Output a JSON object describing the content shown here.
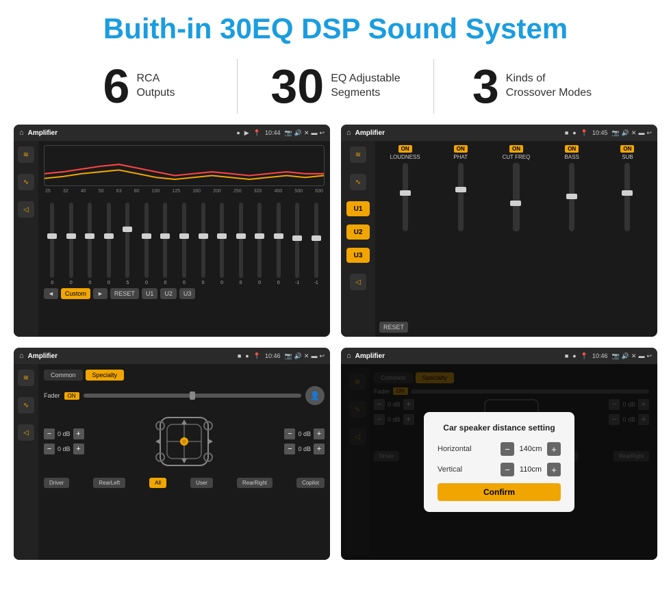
{
  "header": {
    "title": "Buith-in 30EQ DSP Sound System"
  },
  "stats": [
    {
      "number": "6",
      "label_line1": "RCA",
      "label_line2": "Outputs"
    },
    {
      "number": "30",
      "label_line1": "EQ Adjustable",
      "label_line2": "Segments"
    },
    {
      "number": "3",
      "label_line1": "Kinds of",
      "label_line2": "Crossover Modes"
    }
  ],
  "screens": [
    {
      "topbar_title": "Amplifier",
      "topbar_time": "10:44",
      "type": "eq"
    },
    {
      "topbar_title": "Amplifier",
      "topbar_time": "10:45",
      "type": "amp"
    },
    {
      "topbar_title": "Amplifier",
      "topbar_time": "10:46",
      "type": "cs"
    },
    {
      "topbar_title": "Amplifier",
      "topbar_time": "10:46",
      "type": "dialog"
    }
  ],
  "eq": {
    "freq_labels": [
      "25",
      "32",
      "40",
      "50",
      "63",
      "80",
      "100",
      "125",
      "160",
      "200",
      "250",
      "320",
      "400",
      "500",
      "630"
    ],
    "slider_values": [
      "0",
      "0",
      "0",
      "0",
      "5",
      "0",
      "0",
      "0",
      "0",
      "0",
      "0",
      "0",
      "0",
      "-1",
      "0",
      "-1"
    ],
    "preset_label": "Custom",
    "buttons": [
      "RESET",
      "U1",
      "U2",
      "U3"
    ]
  },
  "amp": {
    "u_buttons": [
      "U1",
      "U2",
      "U3"
    ],
    "controls": [
      {
        "label": "LOUDNESS",
        "on": true
      },
      {
        "label": "PHAT",
        "on": true
      },
      {
        "label": "CUT FREQ",
        "on": true
      },
      {
        "label": "BASS",
        "on": true
      },
      {
        "label": "SUB",
        "on": true
      }
    ],
    "reset_label": "RESET"
  },
  "cs": {
    "tabs": [
      "Common",
      "Specialty"
    ],
    "active_tab": 1,
    "fader_label": "Fader",
    "on_label": "ON",
    "vol_rows": [
      {
        "value": "0 dB"
      },
      {
        "value": "0 dB"
      },
      {
        "value": "0 dB"
      },
      {
        "value": "0 dB"
      }
    ],
    "bottom_btns": [
      "Driver",
      "RearLeft",
      "All",
      "User",
      "RearRight",
      "Copilot"
    ]
  },
  "dialog": {
    "title": "Car speaker distance setting",
    "horizontal_label": "Horizontal",
    "horizontal_value": "140cm",
    "vertical_label": "Vertical",
    "vertical_value": "110cm",
    "confirm_label": "Confirm"
  }
}
